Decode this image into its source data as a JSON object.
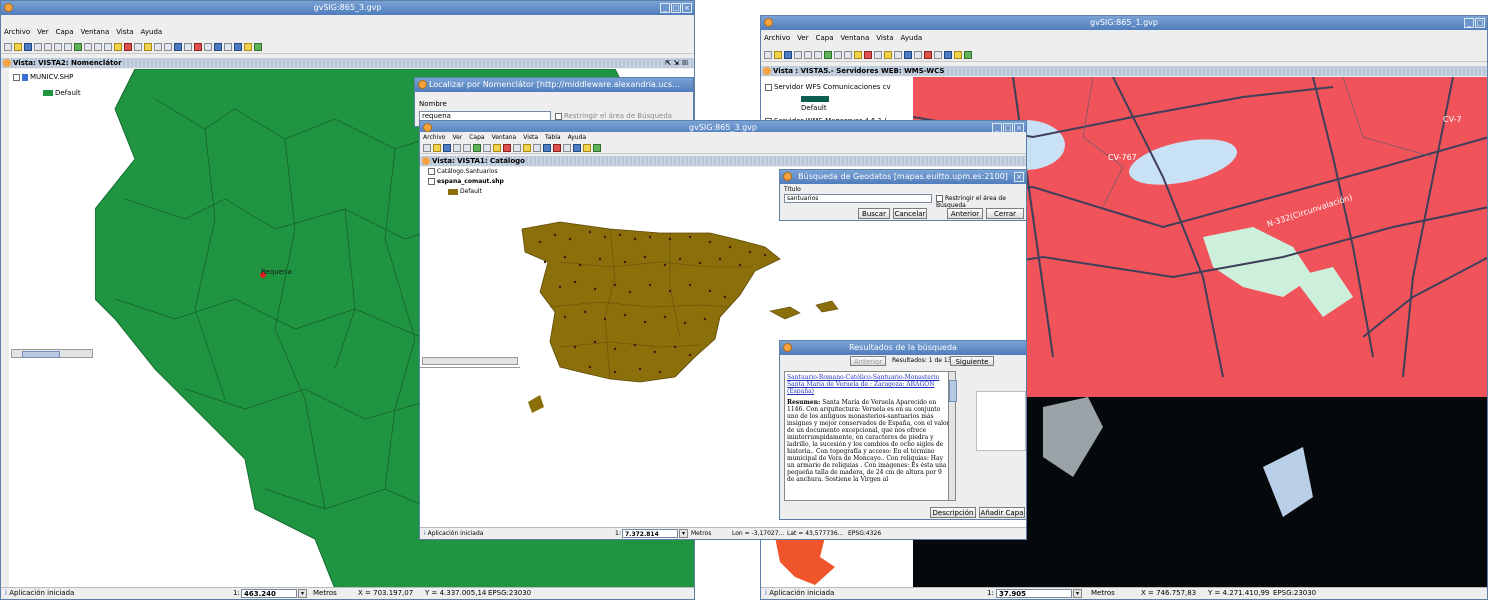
{
  "left_window": {
    "title": "gvSIG:865_3.gvp",
    "menu": [
      "Archivo",
      "Ver",
      "Capa",
      "Ventana",
      "Vista",
      "Ayuda"
    ],
    "view_title": "Vista: VISTA2: Nomenclátor",
    "layers": {
      "layer_name": "MUNICV.SHP",
      "legend": "Default"
    },
    "map_label": "Requena",
    "status": {
      "message": "Aplicación iniciada",
      "scale_prefix": "1:",
      "scale": "463.240",
      "units": "Metros",
      "x": "X = 703.197,07",
      "y": "Y = 4.337.005,14",
      "epsg": "EPSG:23030"
    },
    "colors": {
      "map_fill": "#1f9441",
      "background": "#ffffff"
    }
  },
  "nomenclator_dialog": {
    "title": "Localizar por Nomenclátor [http://middleware.alexandria.ucs...",
    "name_label": "Nombre",
    "name_value": "requena",
    "restrict_label": "Restringir el área de Búsqueda"
  },
  "middle_window": {
    "title": "gvSIG:865_3.gvp",
    "menu": [
      "Archivo",
      "Ver",
      "Capa",
      "Ventana",
      "Vista",
      "Tabla",
      "Ayuda"
    ],
    "view_title": "Vista: VISTA1: Catálogo",
    "layers": [
      "Catálogo.Santuarios",
      "espana_comaut.shp",
      "Default"
    ],
    "status": {
      "message": "Aplicación iniciada",
      "scale_prefix": "1:",
      "scale": "7.372.814",
      "units": "Metros",
      "lon": "Lon = -3,17027...",
      "lat": "Lat = 43,577736...",
      "epsg": "EPSG:4326"
    },
    "colors": {
      "spain_fill": "#8b6f0b",
      "points": "#4a1410"
    }
  },
  "geodata_dialog": {
    "title": "Búsqueda de Geodatos [mapas.euitto.upm.es:2100]",
    "title_label": "Título",
    "title_value": "santuarios",
    "restrict_label": "Restringir el área de Búsqueda",
    "buttons": [
      "Buscar",
      "Cancelar",
      "Anterior",
      "Cerrar"
    ]
  },
  "results_dialog": {
    "title": "Resultados de la búsqueda",
    "prev_button": "Anterior",
    "results_label": "Resultados: 1 de 13",
    "next_button": "Siguiente",
    "link_text": "Santuario-Romano-Católico-Santuario-Monasterio Santa María de Veruela de : Zaragoza: ARAGÓN (España)",
    "summary_label": "Resumen:",
    "summary_text": "Santa María de Veruela Aparecido en 1146. Con arquitectura: Veruela es en su conjunto uno de los antiguos monasterios-santuarios más insignes y mejor conservados de España, con el valor de un documento excepcional, que nos ofrece ininterrumpidamente, en caracteres de piedra y ladrillo, la sucesión y los cambios de ocho siglos de historia.. Con topografía y acceso: En el término municipal de Vera de Moncayo.. Con reliquias: Hay un armario de reliquias . Con imágenes: Es ésta una pequeña talla de madera, de 24 cm de altura por 9 de anchura. Sostiene la Virgen al",
    "buttons": [
      "Descripción",
      "Añadir Capa"
    ]
  },
  "right_window": {
    "title": "gvSIG:865_1.gvp",
    "menu": [
      "Archivo",
      "Ver",
      "Capa",
      "Ventana",
      "Vista",
      "Ayuda"
    ],
    "view_title": "Vista : VISTA5.- Servidores WEB: WMS-WCS",
    "layers": [
      "Servidor WFS Comunicaciones cv",
      "Default",
      "Servidor WMS Mapserver 4.6.1 ("
    ],
    "road_labels": [
      "CV-767",
      "N-332(Circunvalación)",
      "CV-7"
    ],
    "status": {
      "message": "Aplicación iniciada",
      "scale_prefix": "1:",
      "scale": "37.905",
      "units": "Metros",
      "x": "X = 746.757,83",
      "y": "Y = 4.271.410,99",
      "epsg": "EPSG:23030"
    },
    "colors": {
      "urban": "#f0545a",
      "sea": "#06090c",
      "roads": "#3f3f5a"
    }
  }
}
